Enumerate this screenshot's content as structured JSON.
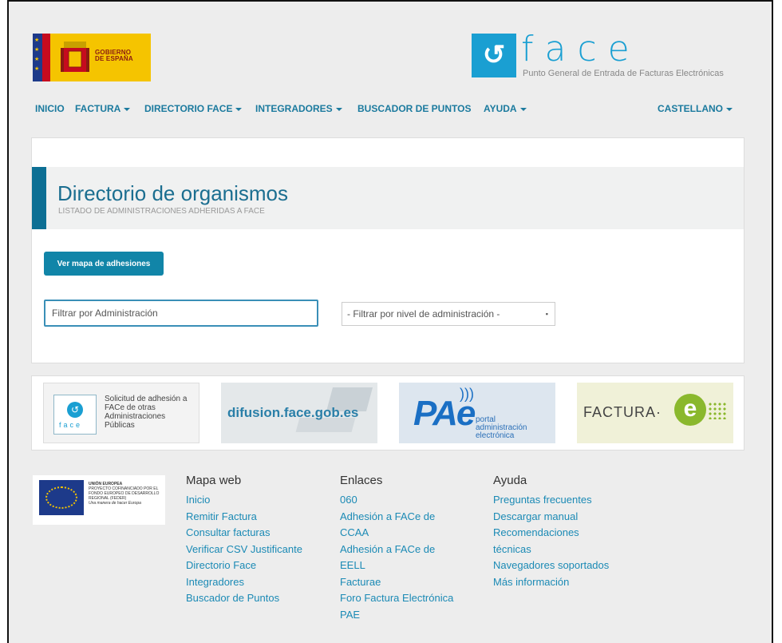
{
  "header": {
    "gov_logo_text": [
      "GOBIERNO",
      "DE ESPAÑA"
    ],
    "face_logo_word": "face",
    "face_logo_subtitle": "Punto General de Entrada de Facturas Electrónicas"
  },
  "nav": {
    "items": [
      {
        "label": "INICIO",
        "dropdown": false
      },
      {
        "label": "FACTURA",
        "dropdown": true
      },
      {
        "label": "DIRECTORIO FACE",
        "dropdown": true
      },
      {
        "label": "INTEGRADORES",
        "dropdown": true
      },
      {
        "label": "BUSCADOR DE PUNTOS",
        "dropdown": false
      },
      {
        "label": "AYUDA",
        "dropdown": true
      }
    ],
    "language": "CASTELLANO"
  },
  "main": {
    "title": "Directorio de organismos",
    "subtitle": "LISTADO DE ADMINISTRACIONES ADHERIDAS A FACE",
    "map_button": "Ver mapa de adhesiones",
    "filter_input_placeholder": "Filtrar por Administración",
    "filter_select_value": "- Filtrar por nivel de administración -"
  },
  "banners": {
    "adhesion": {
      "mini": "face",
      "text": "Solicitud de adhesión a FACe de otras Administraciones Públicas"
    },
    "difusion": {
      "text": "difusion.face.gob.es"
    },
    "pae": {
      "logo": "PAe",
      "text_lines": [
        "portal",
        "administración",
        "electrónica"
      ]
    },
    "factura_e": {
      "text": "FACTURA·",
      "e_letter": "e"
    }
  },
  "footer": {
    "eu_logo_text": {
      "line1": "UNIÓN EUROPEA",
      "line2": "PROYECTO COFINANCIADO POR EL FONDO EUROPEO DE DESARROLLO REGIONAL (FEDER)",
      "line3": "Una manera de hacer Europa"
    },
    "columns": [
      {
        "heading": "Mapa web",
        "links": [
          "Inicio",
          "Remitir Factura",
          "Consultar facturas",
          "Verificar CSV Justificante",
          "Directorio Face",
          "Integradores",
          "Buscador de Puntos"
        ]
      },
      {
        "heading": "Enlaces",
        "links": [
          "060",
          "Adhesión a FACe de",
          "CCAA",
          "Adhesión a FACe de",
          "EELL",
          "Facturae",
          "Foro Factura Electrónica",
          "PAE"
        ]
      },
      {
        "heading": "Ayuda",
        "links": [
          "Preguntas frecuentes",
          "Descargar manual",
          "Recomendaciones",
          "técnicas",
          "Navegadores soportados",
          "Más información"
        ]
      }
    ]
  },
  "colors": {
    "accent": "#1b7a9e",
    "button": "#1185a8",
    "link": "#1b8ab5",
    "title": "#1b6e90"
  }
}
